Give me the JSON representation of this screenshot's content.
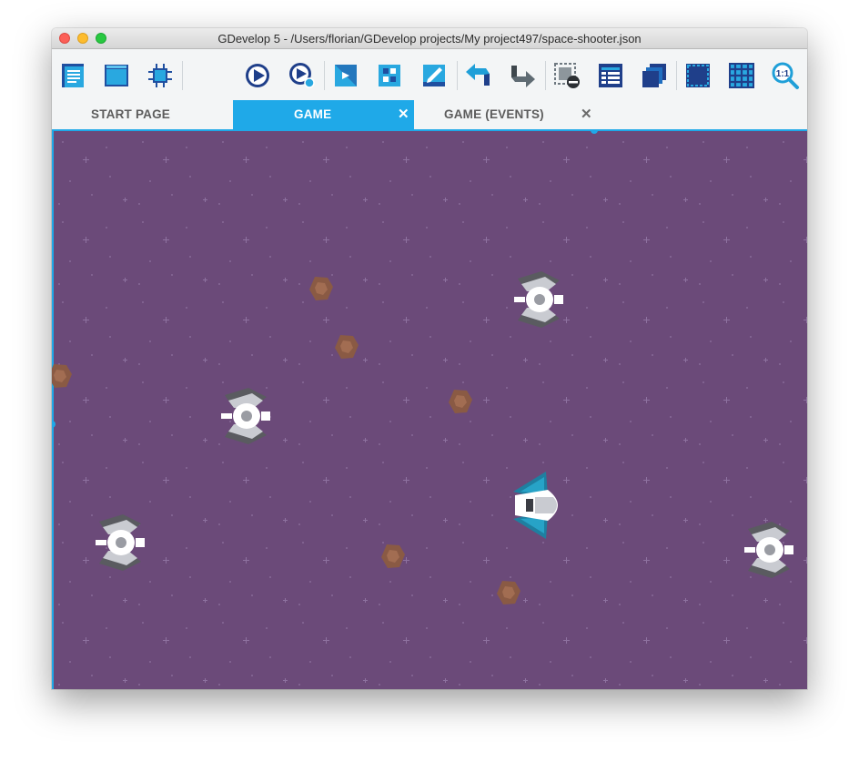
{
  "window": {
    "title": "GDevelop 5 - /Users/florian/GDevelop projects/My project497/space-shooter.json"
  },
  "toolbar": {
    "buttons": [
      "project-manager-icon",
      "scene-editor-icon",
      "extensions-icon",
      "preview-play-icon",
      "debug-preview-icon",
      "objects-icon",
      "object-groups-icon",
      "properties-edit-icon",
      "undo-icon",
      "redo-icon",
      "delete-instance-icon",
      "instances-list-icon",
      "layers-icon",
      "window-mask-icon",
      "grid-icon",
      "zoom-reset-icon"
    ]
  },
  "tabs": [
    {
      "label": "START PAGE",
      "active": false,
      "closable": false
    },
    {
      "label": "GAME",
      "active": true,
      "closable": true,
      "close_glyph": "✕"
    },
    {
      "label": "GAME (EVENTS)",
      "active": false,
      "closable": true,
      "close_glyph": "✕"
    }
  ],
  "scene": {
    "background_color": "#6b4a79",
    "instances": [
      {
        "object": "Enemy",
        "icon": "enemy-ship-icon"
      },
      {
        "object": "Enemy",
        "icon": "enemy-ship-icon"
      },
      {
        "object": "Enemy",
        "icon": "enemy-ship-icon"
      },
      {
        "object": "Enemy",
        "icon": "enemy-ship-icon"
      },
      {
        "object": "Player",
        "icon": "player-ship-icon"
      },
      {
        "object": "Asteroid",
        "icon": "asteroid-icon"
      },
      {
        "object": "Asteroid",
        "icon": "asteroid-icon"
      },
      {
        "object": "Asteroid",
        "icon": "asteroid-icon"
      },
      {
        "object": "Asteroid",
        "icon": "asteroid-icon"
      },
      {
        "object": "Asteroid",
        "icon": "asteroid-icon"
      },
      {
        "object": "Asteroid",
        "icon": "asteroid-icon"
      }
    ]
  },
  "colors": {
    "accent": "#1fa9e8",
    "toolbar_bg": "#f3f5f6",
    "scene_bg": "#6b4a79"
  }
}
